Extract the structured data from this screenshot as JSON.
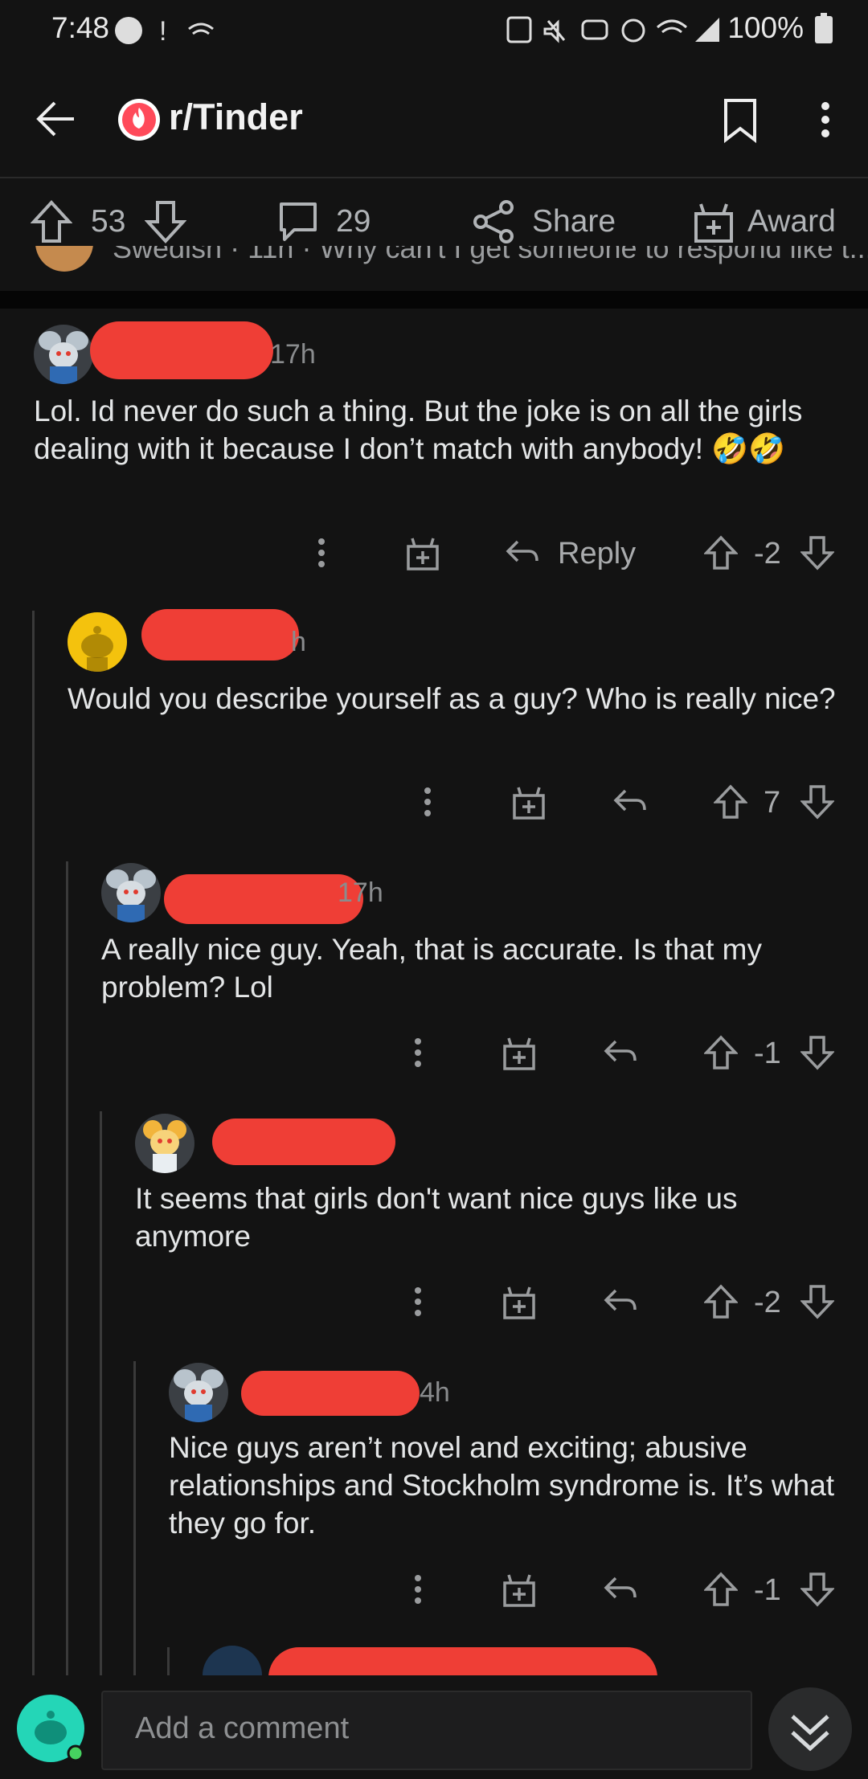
{
  "status_bar": {
    "time": "7:48",
    "battery": "100%"
  },
  "header": {
    "subreddit": "r/Tinder"
  },
  "post_actions": {
    "upvotes": "53",
    "comments": "29",
    "share_label": "Share",
    "award_label": "Award"
  },
  "prev_snippet": "Swedish · 11h · Why can't I get someone to respond like t...",
  "comments": [
    {
      "time": "17h",
      "text": "Lol. Id never do such a thing. But the joke is on all the girls dealing with it because I don’t match with anybody! 🤣🤣",
      "score": "-2",
      "reply_label": "Reply"
    },
    {
      "time": "h",
      "text": "Would you describe yourself as a guy? Who is really nice?",
      "score": "7"
    },
    {
      "time": "17h",
      "text": "A really nice guy. Yeah, that is accurate. Is that my problem? Lol",
      "score": "-1"
    },
    {
      "time": "",
      "text": "It seems that girls don't want nice guys like us anymore",
      "score": "-2"
    },
    {
      "time": "4h",
      "text": "Nice guys aren’t novel and exciting; abusive relationships and Stockholm syndrome is. It’s what they go for.",
      "score": "-1"
    }
  ],
  "composer": {
    "placeholder": "Add a comment"
  },
  "colors": {
    "background": "#131313",
    "redaction": "#ef3e36",
    "accent_teal": "#24d6b7"
  }
}
